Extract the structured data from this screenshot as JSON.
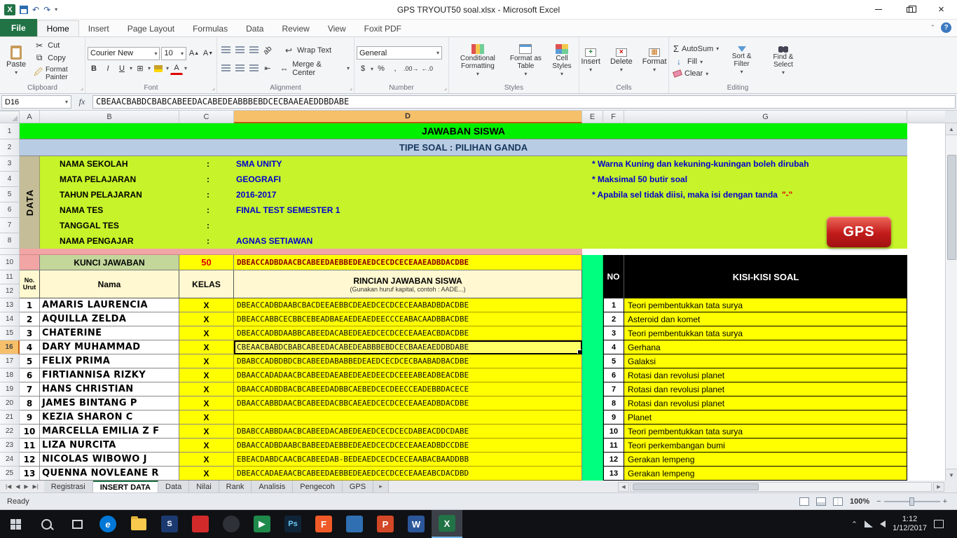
{
  "colors": {
    "title_green": "#00f000",
    "subtitle_blue": "#b8cce4",
    "data_lime": "#c6f32a",
    "cell_yellow": "#ffff00",
    "strip_green": "#00ff7f",
    "data_tab_tan": "#c4bd97",
    "pink": "#f2a5a5",
    "excel_green": "#217346",
    "gps_red": "#c21b1b",
    "value_blue": "#0000cc"
  },
  "window": {
    "title": "GPS TRYOUT50 soal.xlsx  -  Microsoft Excel"
  },
  "ribbon": {
    "tabs": [
      {
        "label": "File"
      },
      {
        "label": "Home"
      },
      {
        "label": "Insert"
      },
      {
        "label": "Page Layout"
      },
      {
        "label": "Formulas"
      },
      {
        "label": "Data"
      },
      {
        "label": "Review"
      },
      {
        "label": "View"
      },
      {
        "label": "Foxit PDF"
      }
    ],
    "clipboard": {
      "paste": "Paste",
      "cut": "Cut",
      "copy": "Copy",
      "format_painter": "Format Painter",
      "group": "Clipboard"
    },
    "font": {
      "name": "Courier New",
      "size": "10",
      "group": "Font"
    },
    "alignment": {
      "wrap": "Wrap Text",
      "merge": "Merge & Center",
      "group": "Alignment"
    },
    "number": {
      "format": "General",
      "group": "Number"
    },
    "styles": {
      "conditional": "Conditional Formatting",
      "format_table": "Format as Table",
      "cell_styles": "Cell Styles",
      "group": "Styles"
    },
    "cells": {
      "insert": "Insert",
      "delete": "Delete",
      "format": "Format",
      "group": "Cells"
    },
    "editing": {
      "autosum": "AutoSum",
      "fill": "Fill",
      "clear": "Clear",
      "sort": "Sort & Filter",
      "find": "Find & Select",
      "group": "Editing"
    }
  },
  "formula_bar": {
    "name_box": "D16",
    "fx": "fx",
    "formula": "CBEAACBABDCBABCABEEDACABEDEABBBEBDCECBAAEAEDDBDABE"
  },
  "grid": {
    "columns": [
      {
        "label": "A"
      },
      {
        "label": "B"
      },
      {
        "label": "C"
      },
      {
        "label": "D"
      },
      {
        "label": "E"
      },
      {
        "label": "F"
      },
      {
        "label": "G"
      }
    ],
    "row_headers": [
      {
        "n": "1"
      },
      {
        "n": "2"
      },
      {
        "n": "3"
      },
      {
        "n": "4"
      },
      {
        "n": "5"
      },
      {
        "n": "6"
      },
      {
        "n": "7"
      },
      {
        "n": "8"
      },
      {
        "n": ""
      },
      {
        "n": "10"
      },
      {
        "n": "11"
      },
      {
        "n": "12"
      },
      {
        "n": "13"
      },
      {
        "n": "14"
      },
      {
        "n": "15"
      },
      {
        "n": "16"
      },
      {
        "n": "17"
      },
      {
        "n": "18"
      },
      {
        "n": "19"
      },
      {
        "n": "20"
      },
      {
        "n": "21"
      },
      {
        "n": "22"
      },
      {
        "n": "23"
      },
      {
        "n": "24"
      },
      {
        "n": "25"
      }
    ],
    "title": "JAWABAN SISWA",
    "subtitle": "TIPE SOAL : PILIHAN GANDA",
    "data_label": "DATA",
    "info": [
      {
        "label": "NAMA SEKOLAH",
        "sep": ":",
        "value": "SMA UNITY"
      },
      {
        "label": "MATA PELAJARAN",
        "sep": ":",
        "value": "GEOGRAFI"
      },
      {
        "label": "TAHUN PELAJARAN",
        "sep": ":",
        "value": "2016-2017"
      },
      {
        "label": "NAMA TES",
        "sep": ":",
        "value": "FINAL TEST SEMESTER 1"
      },
      {
        "label": "TANGGAL TES",
        "sep": ":",
        "value": ""
      },
      {
        "label": "NAMA PENGAJAR",
        "sep": ":",
        "value": "AGNAS SETIAWAN"
      }
    ],
    "notes": {
      "n1": "* Warna Kuning dan kekuning-kuningan boleh dirubah",
      "n2": "* Maksimal 50 butir soal",
      "n3": "* Apabila sel tidak diisi,  maka isi dengan tanda",
      "n3_red": "\"-\""
    },
    "gps": "GPS",
    "kunci": {
      "label": "KUNCI JAWABAN",
      "count": "50",
      "key": "DBEACCADBDAACBCABEEDAEBBEDEAEDCECDCECEAAEADBDACDBE"
    },
    "thead": {
      "no1": "No.",
      "no2": "Urut",
      "nama": "Nama",
      "kelas": "KELAS",
      "rincian": "RINCIAN JAWABAN SISWA",
      "rincian_sub": "(Gunakan huruf kapital, contoh : AADE...)"
    },
    "students": [
      {
        "no": "1",
        "name": "AMARIS LAURENCIA",
        "kelas": "X",
        "answer": "DBEACCADBDAABCBACDEEAEBBCDEAEDCECDCECEAABADBDACDBE"
      },
      {
        "no": "2",
        "name": "AQUILLA ZELDA",
        "kelas": "X",
        "answer": "DBEACCABBCECBBCEBEADBAEAEDEAEDEECCCEABACAADBBACDBE"
      },
      {
        "no": "3",
        "name": "CHATERINE",
        "kelas": "X",
        "answer": "DBEACCADBDAABBCABEEDACABEDEAEDCECDCECEAAEACBDACDBE"
      },
      {
        "no": "4",
        "name": "DARY MUHAMMAD",
        "kelas": "X",
        "answer": "CBEAACBABDCBABCABEEDACABEDEABBBEBDCECBAAEAEDDBDABE"
      },
      {
        "no": "5",
        "name": "FELIX PRIMA",
        "kelas": "X",
        "answer": "DBABCCADBDBDCBCABEEDABABBEDEAEDCECDCECBAABADBACDBE"
      },
      {
        "no": "6",
        "name": "FIRTIANNISA RIZKY",
        "kelas": "X",
        "answer": "DBAACCADADAACBCABEEDAEABEDEAEDEECDCEEEABEADBEACDBE"
      },
      {
        "no": "7",
        "name": "HANS CHRISTIAN",
        "kelas": "X",
        "answer": "DBAACCADBDBACBCABEEDADBBCAEBEDCECDEECCEADEBBDACECE"
      },
      {
        "no": "8",
        "name": "JAMES BINTANG P",
        "kelas": "X",
        "answer": "DBAACCABBDAACBCABEEDACBBCAEAEDCECDCECEAAEADBDACDBE"
      },
      {
        "no": "9",
        "name": "KEZIA SHARON C",
        "kelas": "X",
        "answer": ""
      },
      {
        "no": "10",
        "name": "MARCELLA EMILIA Z F",
        "kelas": "X",
        "answer": "DBABCCABBDAACBCABEEDACABEDEAEDCECDCECDABEACDDCDABE"
      },
      {
        "no": "11",
        "name": "LIZA NURCITA",
        "kelas": "X",
        "answer": "DBAACCADBDAABCBABEEDAEBBEDEAEDCECDCECEAAEADBDCCDBE"
      },
      {
        "no": "12",
        "name": "NICOLAS WIBOWO J",
        "kelas": "X",
        "answer": "EBEACDABDCAACBCABEEDAB-BEDEAEDCECDCECEAABACBAADDBB"
      },
      {
        "no": "13",
        "name": "QUENNA NOVLEANE R",
        "kelas": "X",
        "answer": "DBEACCADAEAACBCABEEDAEBBEDEAEDCECDCECEAAEABCDACDBD"
      }
    ],
    "kisi": {
      "no_header": "NO",
      "title": "KISI-KISI SOAL",
      "items": [
        {
          "no": "1",
          "topic": "Teori pembentukkan tata surya"
        },
        {
          "no": "2",
          "topic": "Asteroid dan komet"
        },
        {
          "no": "3",
          "topic": "Teori pembentukkan tata surya"
        },
        {
          "no": "4",
          "topic": "Gerhana"
        },
        {
          "no": "5",
          "topic": "Galaksi"
        },
        {
          "no": "6",
          "topic": "Rotasi dan revolusi planet"
        },
        {
          "no": "7",
          "topic": "Rotasi dan revolusi planet"
        },
        {
          "no": "8",
          "topic": "Rotasi dan revolusi planet"
        },
        {
          "no": "9",
          "topic": "Planet"
        },
        {
          "no": "10",
          "topic": "Teori pembentukkan tata surya"
        },
        {
          "no": "11",
          "topic": "Teori perkembangan bumi"
        },
        {
          "no": "12",
          "topic": "Gerakan lempeng"
        },
        {
          "no": "13",
          "topic": "Gerakan lempeng"
        }
      ]
    }
  },
  "sheet_tabs": {
    "tabs": [
      {
        "label": "Registrasi"
      },
      {
        "label": "INSERT DATA"
      },
      {
        "label": "Data"
      },
      {
        "label": "Nilai"
      },
      {
        "label": "Rank"
      },
      {
        "label": "Analisis"
      },
      {
        "label": "Pengecoh"
      },
      {
        "label": "GPS"
      }
    ],
    "active": "INSERT DATA"
  },
  "status_bar": {
    "mode": "Ready",
    "zoom": "100%"
  },
  "taskbar": {
    "apps": {
      "edge": "e",
      "store": "S",
      "photoshop": "Ps",
      "foxit": "F",
      "powerpoint": "P",
      "word": "W",
      "excel": "X"
    },
    "time": "1:12",
    "date": "1/12/2017"
  }
}
